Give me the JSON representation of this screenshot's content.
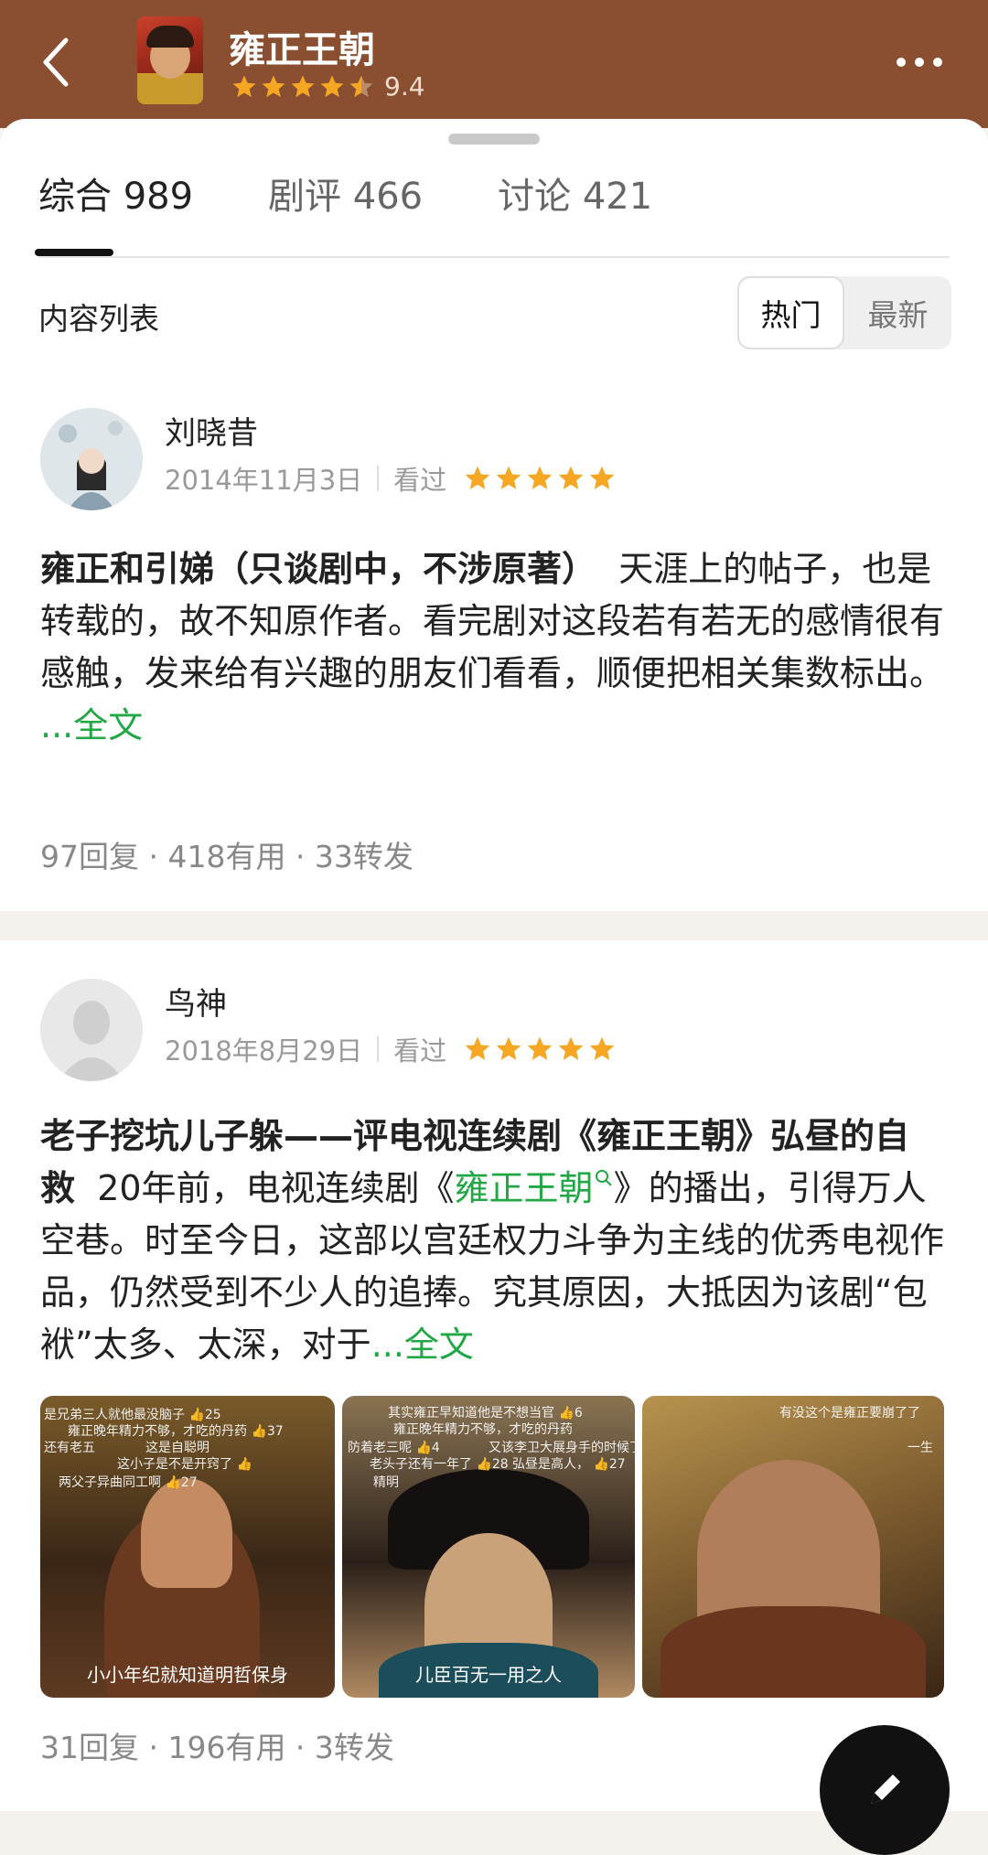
{
  "header": {
    "title": "雍正王朝",
    "rating": {
      "score_text": "9.4",
      "stars": 4.5
    },
    "colors": {
      "header_bg": "#8a4f30",
      "star": "#f5a623",
      "link": "#22a745"
    }
  },
  "tabs": [
    {
      "label": "综合 989",
      "active": true
    },
    {
      "label": "剧评 466",
      "active": false
    },
    {
      "label": "讨论 421",
      "active": false
    }
  ],
  "content_list": {
    "label": "内容列表",
    "sort_options": [
      {
        "label": "热门",
        "active": true
      },
      {
        "label": "最新",
        "active": false
      }
    ]
  },
  "posts": [
    {
      "author": "刘晓昔",
      "date": "2014年11月3日",
      "status": "看过",
      "stars": 5,
      "title": "雍正和引娣（只谈剧中，不涉原著）",
      "excerpt": "天涯上的帖子，也是转载的，故不知原作者。看完剧对这段若有若无的感情很有感触，发来给有兴趣的朋友们看看，顺便把相关集数标出。",
      "more": "...全文",
      "stats": "97回复 · 418有用 · 33转发"
    },
    {
      "author": "鸟神",
      "date": "2018年8月29日",
      "status": "看过",
      "stars": 5,
      "title": "老子挖坑儿子躲——评电视连续剧《雍正王朝》弘昼的自救",
      "excerpt_before": "20年前，电视连续剧《",
      "excerpt_link": "雍正王朝",
      "excerpt_after": "》的播出，引得万人空巷。时至今日，这部以宫廷权力斗争为主线的优秀电视作品，仍然受到不少人的追捧。究其原因，大抵因为该剧“包袱”太多、太深，对于",
      "more": "...全文",
      "images": [
        {
          "caption": "小小年纪就知道明哲保身",
          "danmu": [
            "是兄弟三人就他最没脑子 👍25",
            "雍正晚年精力不够，才吃的丹药 👍37",
            "还有老五",
            "这是自聪明",
            "这小子是不是开窍了 👍",
            "两父子异曲同工啊 👍27"
          ]
        },
        {
          "caption": "儿臣百无一用之人",
          "danmu": [
            "其实雍正早知道他是不想当官 👍6",
            "雍正晚年精力不够，才吃的丹药",
            "防着老三呢 👍4",
            "又该李卫大展身手的时候了",
            "老头子还有一年了 👍28",
            "弘昼是高人， 👍27",
            "精明"
          ]
        },
        {
          "caption": "",
          "danmu": [
            "有没这个是雍正要崩了了",
            "一生"
          ]
        }
      ],
      "stats": "31回复 · 196有用 · 3转发"
    }
  ]
}
